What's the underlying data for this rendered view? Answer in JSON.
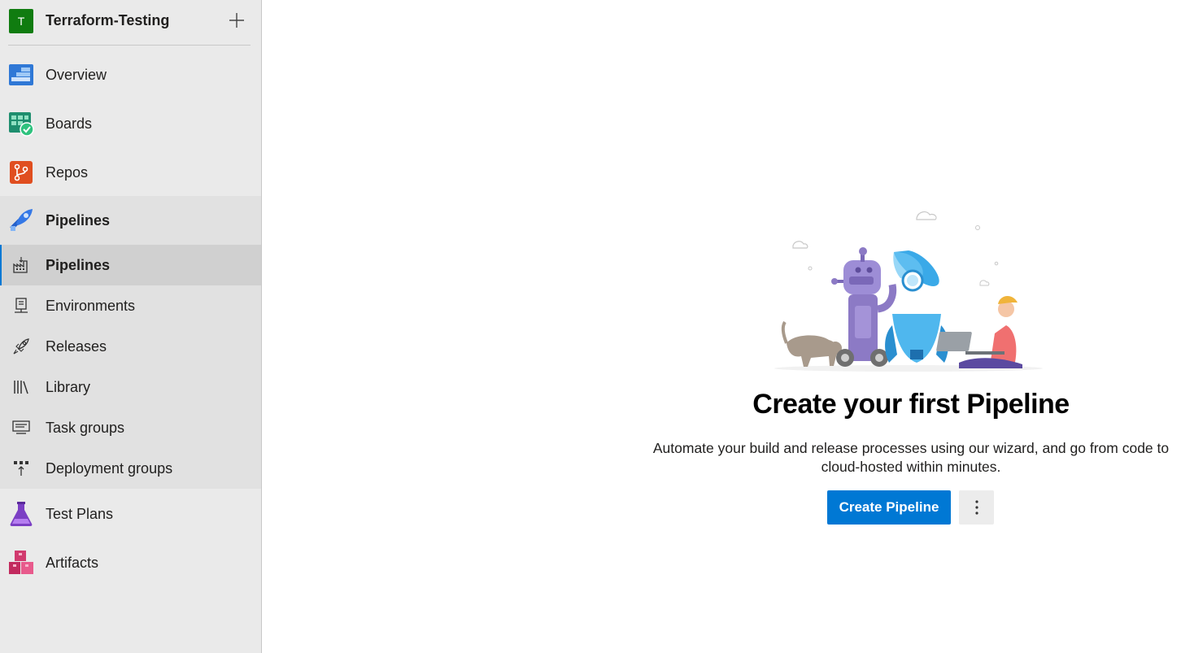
{
  "project": {
    "initial": "T",
    "name": "Terraform-Testing",
    "avatar_color": "#107c10"
  },
  "nav": {
    "overview": "Overview",
    "boards": "Boards",
    "repos": "Repos",
    "pipelines": "Pipelines",
    "test_plans": "Test Plans",
    "artifacts": "Artifacts"
  },
  "pipelines_sub": {
    "pipelines": "Pipelines",
    "environments": "Environments",
    "releases": "Releases",
    "library": "Library",
    "task_groups": "Task groups",
    "deployment_groups": "Deployment groups"
  },
  "main": {
    "title": "Create your first Pipeline",
    "description": "Automate your build and release processes using our wizard, and go from code to cloud-hosted within minutes.",
    "create_button": "Create Pipeline"
  },
  "colors": {
    "accent": "#0078d4",
    "sidebar_bg": "#eaeaea"
  }
}
